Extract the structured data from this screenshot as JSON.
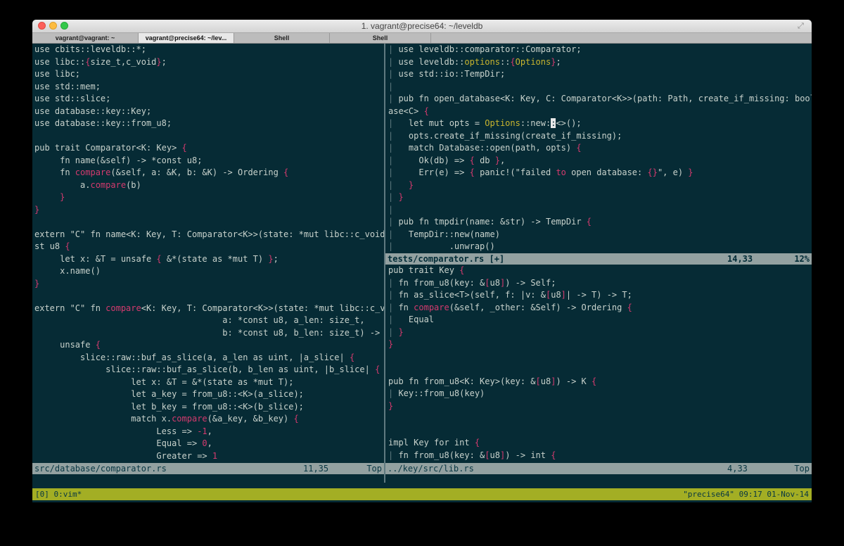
{
  "window": {
    "title": "1. vagrant@precise64: ~/leveldb"
  },
  "tabs": [
    {
      "label": "vagrant@vagrant: ~"
    },
    {
      "label": "vagrant@precise64: ~/lev..."
    },
    {
      "label": "Shell"
    },
    {
      "label": "Shell"
    }
  ],
  "left_pane": {
    "file": "src/database/comparator.rs",
    "position": "11,35",
    "scroll": "Top"
  },
  "right_top_pane": {
    "file": "tests/comparator.rs [+]",
    "position": "14,33",
    "scroll": "12%"
  },
  "right_bottom_pane": {
    "file": "../key/src/lib.rs",
    "position": "4,33",
    "scroll": "Top"
  },
  "tmux": {
    "left": "[0] 0:vim*",
    "right": "\"precise64\" 09:17 01-Nov-14"
  },
  "colors": {
    "background": "#062b35",
    "keyword_pink": "#d43a6e",
    "yellow": "#c9b52e",
    "tmux_bar": "#a3ae24"
  }
}
